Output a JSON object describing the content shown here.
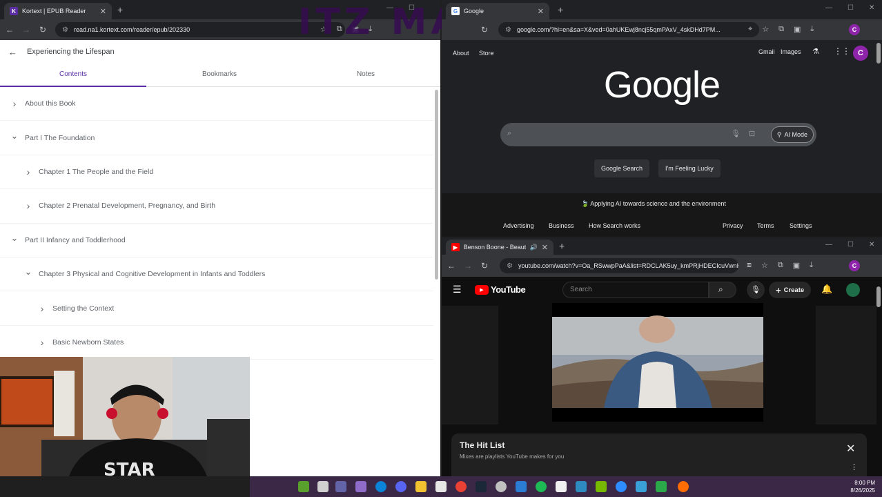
{
  "kortext": {
    "tab_title": "Kortext | EPUB Reader",
    "favicon_letter": "K",
    "url": "read.na1.kortext.com/reader/epub/202330",
    "book_title": "Experiencing the Lifespan",
    "tabs": [
      "Contents",
      "Bookmarks",
      "Notes"
    ],
    "toc": [
      {
        "label": "About this Book",
        "level": 0,
        "expanded": false
      },
      {
        "label": "Part I The Foundation",
        "level": 0,
        "expanded": true
      },
      {
        "label": "Chapter 1 The People and the Field",
        "level": 1,
        "expanded": false
      },
      {
        "label": "Chapter 2 Prenatal Development, Pregnancy, and Birth",
        "level": 1,
        "expanded": false
      },
      {
        "label": "Part II Infancy and Toddlerhood",
        "level": 0,
        "expanded": true
      },
      {
        "label": "Chapter 3 Physical and Cognitive Development in Infants and Toddlers",
        "level": 1,
        "expanded": true
      },
      {
        "label": "Setting the Context",
        "level": 2,
        "expanded": false
      },
      {
        "label": "Basic Newborn States",
        "level": 2,
        "expanded": false
      }
    ]
  },
  "google": {
    "tab_title": "Google",
    "url": "google.com/?hl=en&sa=X&ved=0ahUKEwj8ncj55qmPAxV_4skDHd7PM...",
    "top_left": [
      "About",
      "Store"
    ],
    "top_right": [
      "Gmail",
      "Images"
    ],
    "avatar_letter": "C",
    "logo": "Google",
    "ai_mode": "AI Mode",
    "buttons": [
      "Google Search",
      "I'm Feeling Lucky"
    ],
    "promo": "Applying AI towards science and the environment",
    "footer_left": [
      "Advertising",
      "Business",
      "How Search works"
    ],
    "footer_right": [
      "Privacy",
      "Terms",
      "Settings"
    ]
  },
  "youtube": {
    "tab_title": "Benson Boone - Beautiful T",
    "url": "youtube.com/watch?v=Oa_RSwwpPaA&list=RDCLAK5uy_kmPRjHDECIcuVwnK...",
    "logo": "YouTube",
    "search_placeholder": "Search",
    "create": "Create",
    "hitlist_title": "The Hit List",
    "hitlist_sub": "Mixes are playlists YouTube makes for you"
  },
  "watermark": "ITZ MASH",
  "taskbar": {
    "time": "8:00 PM",
    "date": "8/26/2025"
  },
  "colors": {
    "kortext_accent": "#5b2ea6",
    "youtube_red": "#ff0000",
    "taskbar": "#3a2846"
  }
}
